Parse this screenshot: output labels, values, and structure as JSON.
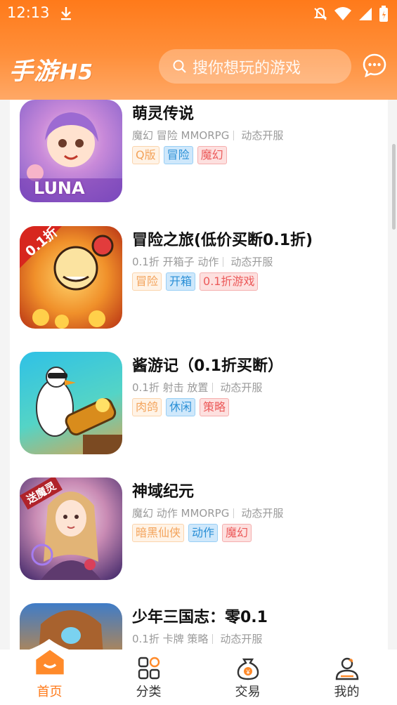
{
  "status_bar": {
    "time": "12:13"
  },
  "header": {
    "logo_text": "手游",
    "logo_suffix": "H5",
    "search_placeholder": "搜你想玩的游戏"
  },
  "games": [
    {
      "name": "萌灵传说",
      "meta": "魔幻 冒险 MMORPG",
      "extra": "动态开服",
      "thumb_text": "LUNA",
      "tags": [
        {
          "label": "Q版",
          "style": "o"
        },
        {
          "label": "冒险",
          "style": "b"
        },
        {
          "label": "魔幻",
          "style": "r"
        }
      ]
    },
    {
      "name": "冒险之旅(低价买断0.1折)",
      "meta": "0.1折 开箱子 动作",
      "extra": "动态开服",
      "thumb_text": "0.1折",
      "tags": [
        {
          "label": "冒险",
          "style": "o"
        },
        {
          "label": "开箱",
          "style": "b"
        },
        {
          "label": "0.1折游戏",
          "style": "r"
        }
      ]
    },
    {
      "name": "酱游记（0.1折买断）",
      "meta": "0.1折 射击 放置",
      "extra": "动态开服",
      "thumb_text": "",
      "tags": [
        {
          "label": "肉鸽",
          "style": "o"
        },
        {
          "label": "休闲",
          "style": "b"
        },
        {
          "label": "策略",
          "style": "r"
        }
      ]
    },
    {
      "name": "神域纪元",
      "meta": "魔幻 动作 MMORPG",
      "extra": "动态开服",
      "thumb_text": "送魔灵",
      "tags": [
        {
          "label": "暗黑仙侠",
          "style": "o"
        },
        {
          "label": "动作",
          "style": "b"
        },
        {
          "label": "魔幻",
          "style": "r"
        }
      ]
    },
    {
      "name": "少年三国志：零0.1",
      "meta": "0.1折 卡牌 策略",
      "extra": "动态开服",
      "thumb_text": "",
      "tags": []
    }
  ],
  "tabbar": [
    {
      "label": "首页",
      "icon": "home-icon",
      "active": true
    },
    {
      "label": "分类",
      "icon": "category-icon",
      "active": false
    },
    {
      "label": "交易",
      "icon": "trade-money-bag-icon",
      "active": false
    },
    {
      "label": "我的",
      "icon": "profile-icon",
      "active": false
    }
  ],
  "colors": {
    "accent": "#ff7a1a",
    "tag_orange": "#f3a35b",
    "tag_blue": "#2a8fd6",
    "tag_red": "#ec5a5a"
  }
}
